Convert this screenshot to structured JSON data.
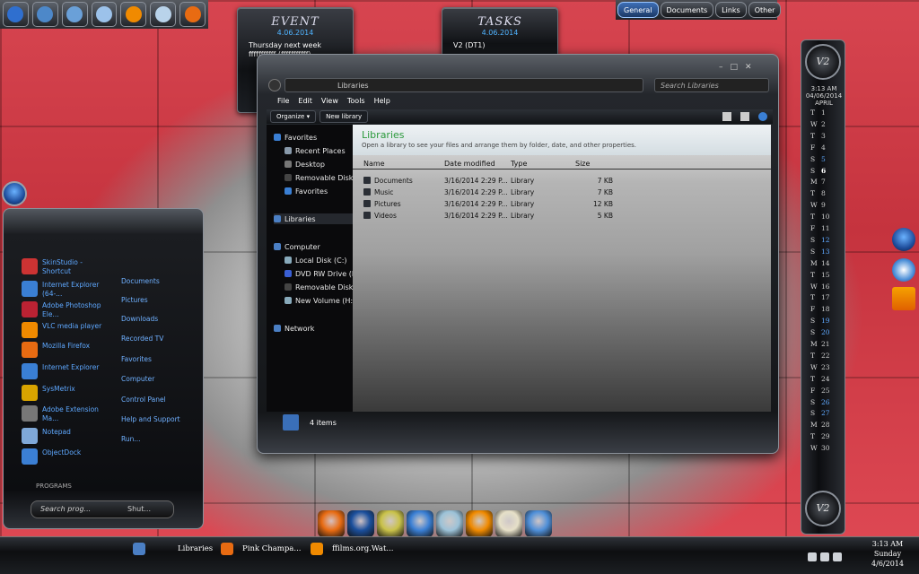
{
  "colors": {
    "accent": "#4fb3ff",
    "library_title": "#2c9a3c",
    "link_blue": "#5ea8ff",
    "wallpaper": "#d74550"
  },
  "launcher": {
    "icons": [
      "windows-orb-icon",
      "globe-icon",
      "globe-icon",
      "cloud-icon",
      "vlc-icon",
      "mail-icon",
      "firefox-icon"
    ]
  },
  "event": {
    "title": "EVENT",
    "date": "4.06.2014",
    "lines": [
      "Thursday next week",
      "fffffffffff (fffffffffff)"
    ]
  },
  "tasks": {
    "title": "TASKS",
    "date": "4.06.2014",
    "lines": [
      "V2 (DT1)"
    ]
  },
  "top_tabs": [
    "General",
    "Documents",
    "Links",
    "Other"
  ],
  "explorer": {
    "address": "Libraries",
    "search_placeholder": "Search Libraries",
    "menu": [
      "File",
      "Edit",
      "View",
      "Tools",
      "Help"
    ],
    "cmd": {
      "organize": "Organize ▾",
      "new_library": "New library"
    },
    "nav": {
      "favorites": "Favorites",
      "fav_items": [
        "Recent Places",
        "Desktop",
        "Removable Disk (G:)",
        "Favorites"
      ],
      "libraries": "Libraries",
      "computer": "Computer",
      "computer_items": [
        "Local Disk (C:)",
        "DVD RW Drive (E:)",
        "Removable Disk (G:)",
        "New Volume (H:)"
      ],
      "network": "Network"
    },
    "header": {
      "title": "Libraries",
      "subtitle": "Open a library to see your files and arrange them by folder, date, and other properties."
    },
    "columns": {
      "name": "Name",
      "date": "Date modified",
      "type": "Type",
      "size": "Size"
    },
    "rows": [
      {
        "name": "Documents",
        "date": "3/16/2014 2:29 P...",
        "type": "Library",
        "size": "7 KB"
      },
      {
        "name": "Music",
        "date": "3/16/2014 2:29 P...",
        "type": "Library",
        "size": "7 KB"
      },
      {
        "name": "Pictures",
        "date": "3/16/2014 2:29 P...",
        "type": "Library",
        "size": "12 KB"
      },
      {
        "name": "Videos",
        "date": "3/16/2014 2:29 P...",
        "type": "Library",
        "size": "5 KB"
      }
    ],
    "status": "4 items"
  },
  "startmenu": {
    "programs": [
      {
        "label": "SkinStudio - Shortcut",
        "icon": "skinstudio-icon",
        "color": "#c33"
      },
      {
        "label": "Internet Explorer (64-...",
        "icon": "ie-icon",
        "color": "#3a7fd4"
      },
      {
        "label": "Adobe Photoshop Ele...",
        "icon": "photoshop-icon",
        "color": "#b23"
      },
      {
        "label": "VLC media player",
        "icon": "vlc-icon",
        "color": "#f08a00"
      },
      {
        "label": "Mozilla Firefox",
        "icon": "firefox-icon",
        "color": "#e86b12"
      },
      {
        "label": "Internet Explorer",
        "icon": "ie-icon",
        "color": "#3a7fd4"
      },
      {
        "label": "SysMetrix",
        "icon": "sysmetrix-icon",
        "color": "#d8a400"
      },
      {
        "label": "Adobe Extension Ma...",
        "icon": "extension-manager-icon",
        "color": "#777"
      },
      {
        "label": "Notepad",
        "icon": "notepad-icon",
        "color": "#7fa8d8"
      },
      {
        "label": "ObjectDock",
        "icon": "objectdock-icon",
        "color": "#3b7fd4"
      }
    ],
    "links": [
      "Documents",
      "Pictures",
      "Downloads",
      "Recorded TV",
      "Favorites",
      "Computer",
      "Control Panel",
      "Help and Support",
      "Run..."
    ],
    "programs_footer": "PROGRAMS",
    "search_placeholder": "Search prog...",
    "shutdown": "Shut..."
  },
  "calendar": {
    "top_cap": "V2",
    "bottom_cap": "V2",
    "time": "3:13 AM",
    "date": "04/06/2014",
    "month": "APRIL",
    "days": [
      {
        "l": "T",
        "n": "1"
      },
      {
        "l": "W",
        "n": "2"
      },
      {
        "l": "T",
        "n": "3"
      },
      {
        "l": "F",
        "n": "4"
      },
      {
        "l": "S",
        "n": "5"
      },
      {
        "l": "S",
        "n": "6"
      },
      {
        "l": "M",
        "n": "7"
      },
      {
        "l": "T",
        "n": "8"
      },
      {
        "l": "W",
        "n": "9"
      },
      {
        "l": "T",
        "n": "10"
      },
      {
        "l": "F",
        "n": "11"
      },
      {
        "l": "S",
        "n": "12"
      },
      {
        "l": "S",
        "n": "13"
      },
      {
        "l": "M",
        "n": "14"
      },
      {
        "l": "T",
        "n": "15"
      },
      {
        "l": "W",
        "n": "16"
      },
      {
        "l": "T",
        "n": "17"
      },
      {
        "l": "F",
        "n": "18"
      },
      {
        "l": "S",
        "n": "19"
      },
      {
        "l": "S",
        "n": "20"
      },
      {
        "l": "M",
        "n": "21"
      },
      {
        "l": "T",
        "n": "22"
      },
      {
        "l": "W",
        "n": "23"
      },
      {
        "l": "T",
        "n": "24"
      },
      {
        "l": "F",
        "n": "25"
      },
      {
        "l": "S",
        "n": "26"
      },
      {
        "l": "S",
        "n": "27"
      },
      {
        "l": "M",
        "n": "28"
      },
      {
        "l": "T",
        "n": "29"
      },
      {
        "l": "W",
        "n": "30"
      }
    ]
  },
  "dock": [
    {
      "name": "firefox-icon",
      "color": "#e86b12"
    },
    {
      "name": "photoshop-icon",
      "color": "#1b4f9c"
    },
    {
      "name": "paint-icon",
      "color": "#c9c24a"
    },
    {
      "name": "ie-icon",
      "color": "#3a7fd4"
    },
    {
      "name": "recycle-bin-icon",
      "color": "#9cc2d8"
    },
    {
      "name": "vlc-icon",
      "color": "#f08a00"
    },
    {
      "name": "clock-icon",
      "color": "#e6e0c8"
    },
    {
      "name": "settings-icon",
      "color": "#4f8fd8"
    }
  ],
  "taskbar": {
    "items": [
      {
        "label": "Libraries",
        "icon": "explorer-icon",
        "color": "#4b7fc4"
      },
      {
        "label": "Pink Champa...",
        "icon": "firefox-icon",
        "color": "#e86b12"
      },
      {
        "label": "ffilms.org.Wat...",
        "icon": "vlc-icon",
        "color": "#f08a00"
      }
    ],
    "clock": {
      "time": "3:13 AM",
      "day": "Sunday",
      "date": "4/6/2014"
    }
  }
}
